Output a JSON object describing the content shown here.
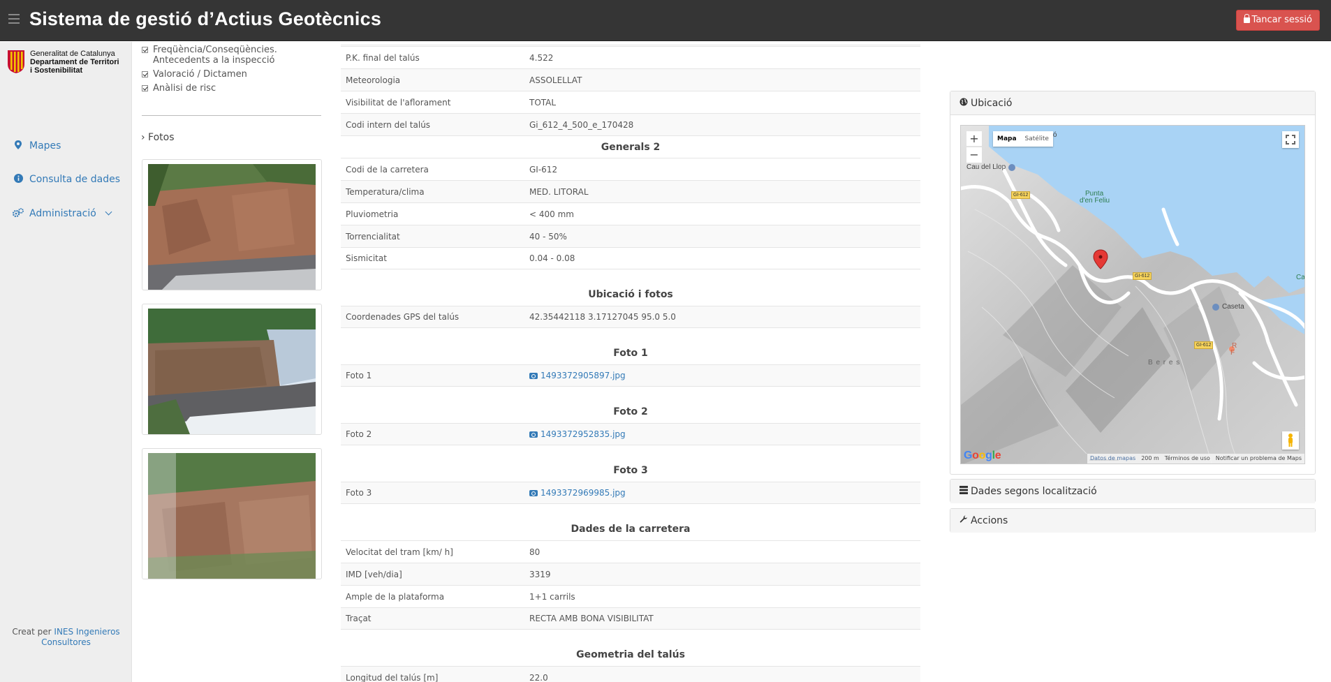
{
  "app": {
    "title": "Sistema de gestió d’Actius Geotècnics",
    "logout_label": "Tancar sessió"
  },
  "sidebar": {
    "logo": {
      "line1": "Generalitat de Catalunya",
      "line2": "Departament de Territori",
      "line3": "i Sostenibilitat"
    },
    "items": [
      {
        "label": "Mapes",
        "icon": "map-marker-icon"
      },
      {
        "label": "Consulta de dades",
        "icon": "info-circle-icon"
      },
      {
        "label": "Administració",
        "icon": "cogs-icon"
      }
    ],
    "credit_prefix": "Creat per",
    "credit_link": "INES Ingenieros Consultores"
  },
  "filters": {
    "options": [
      {
        "label": "Freqüència/Conseqüències. Antecedents a la inspecció",
        "checked": true
      },
      {
        "label": "Valoració / Dictamen",
        "checked": true
      },
      {
        "label": "Anàlisi de risc",
        "checked": true
      }
    ],
    "fotos_label": "› Fotos"
  },
  "details": {
    "rows_top": [
      {
        "key": "P.K. final del talús",
        "value": "4.522"
      },
      {
        "key": "Meteorologia",
        "value": "ASSOLELLAT"
      },
      {
        "key": "Visibilitat de l'aflorament",
        "value": "TOTAL"
      },
      {
        "key": "Codi intern del talús",
        "value": "Gi_612_4_500_e_170428"
      }
    ],
    "generals2_title": "Generals 2",
    "generals2": [
      {
        "key": "Codi de la carretera",
        "value": "GI-612"
      },
      {
        "key": "Temperatura/clima",
        "value": "MED. LITORAL"
      },
      {
        "key": "Pluviometria",
        "value": "< 400 mm"
      },
      {
        "key": "Torrencialitat",
        "value": "40 - 50%"
      },
      {
        "key": "Sismicitat",
        "value": "0.04 - 0.08"
      }
    ],
    "ubicacio_title": "Ubicació i fotos",
    "gps_key": "Coordenades GPS del talús",
    "gps_value": "42.35442118 3.17127045 95.0 5.0",
    "foto1_title": "Foto 1",
    "foto1_key": "Foto 1",
    "foto1_file": "1493372905897.jpg",
    "foto2_title": "Foto 2",
    "foto2_key": "Foto 2",
    "foto2_file": "1493372952835.jpg",
    "foto3_title": "Foto 3",
    "foto3_key": "Foto 3",
    "foto3_file": "1493372969985.jpg",
    "carretera_title": "Dades de la carretera",
    "carretera": [
      {
        "key": "Velocitat del tram [km/ h]",
        "value": "80"
      },
      {
        "key": "IMD [veh/dia]",
        "value": "3319"
      },
      {
        "key": "Ample de la plataforma",
        "value": "1+1 carrils"
      },
      {
        "key": "Traçat",
        "value": "RECTA AMB BONA VISIBILITAT"
      }
    ],
    "geometria_title": "Geometria del talús",
    "geometria": [
      {
        "key": "Longitud del talús [m]",
        "value": "22.0"
      }
    ]
  },
  "panels": {
    "ubicacio": "Ubicació",
    "dades": "Dades segons localització",
    "accions": "Accions"
  },
  "map": {
    "type_map": "Mapa",
    "type_sat": "Satélite",
    "zoom_in": "+",
    "zoom_out": "−",
    "labels": {
      "falco": "l Falcó",
      "llop": "Cau del Llop",
      "punta": "Punta",
      "feliu": "d'en Feliu",
      "caseta": "Caseta",
      "beres": "B e r e s",
      "cap": "Ca",
      "r1": "R",
      "f1": "F"
    },
    "roads": [
      "GI-612",
      "GI-612",
      "GI-612"
    ],
    "google": "Google",
    "footer": {
      "data": "Datos de mapas",
      "scale": "200 m",
      "terms": "Términos de uso",
      "report": "Notificar un problema de Maps"
    }
  },
  "colors": {
    "topbar": "#353535",
    "accent": "#337ab7",
    "danger": "#d9534f",
    "sea": "#a9d3f5"
  }
}
